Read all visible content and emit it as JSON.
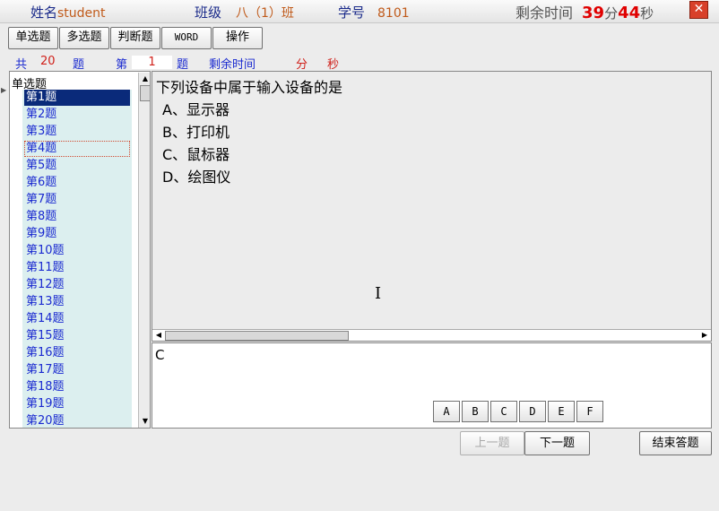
{
  "header": {
    "name_label": "姓名",
    "name_value": "student",
    "class_label": "班级",
    "class_value": "八（1）班",
    "student_id_label": "学号",
    "student_id_value": "8101",
    "timer_label": "剩余时间",
    "timer_minutes": "39",
    "timer_minutes_unit": "分",
    "timer_seconds": "44",
    "timer_seconds_unit": "秒",
    "close_label": "✕"
  },
  "toolbar": {
    "tabs": [
      "单选题",
      "多选题",
      "判断题",
      "WORD",
      "操作"
    ]
  },
  "info": {
    "total_prefix": "共",
    "total_count": "20",
    "total_suffix": "题",
    "current_prefix": "第",
    "current_number": "1",
    "current_suffix": "题",
    "remaining_label": "剩余时间",
    "minutes_unit": "分",
    "seconds_unit": "秒"
  },
  "question_list": {
    "header": "单选题",
    "selected_index": 0,
    "focused_index": 3,
    "items": [
      "第1题",
      "第2题",
      "第3题",
      "第4题",
      "第5题",
      "第6题",
      "第7题",
      "第8题",
      "第9题",
      "第10题",
      "第11题",
      "第12题",
      "第13题",
      "第14题",
      "第15题",
      "第16题",
      "第17题",
      "第18题",
      "第19题",
      "第20题"
    ]
  },
  "question": {
    "text": "下列设备中属于输入设备的是",
    "options": [
      "A、显示器",
      "B、打印机",
      "C、鼠标器",
      "D、绘图仪"
    ]
  },
  "answer": {
    "value": "C",
    "buttons": [
      "A",
      "B",
      "C",
      "D",
      "E",
      "F"
    ]
  },
  "navigation": {
    "prev_label": "上一题",
    "next_label": "下一题",
    "finish_label": "结束答题"
  },
  "icons": {
    "up_arrow": "▲",
    "down_arrow": "▼",
    "left_arrow": "◀",
    "right_arrow": "▶",
    "side_arrow": "▶",
    "ibeam": "I"
  }
}
